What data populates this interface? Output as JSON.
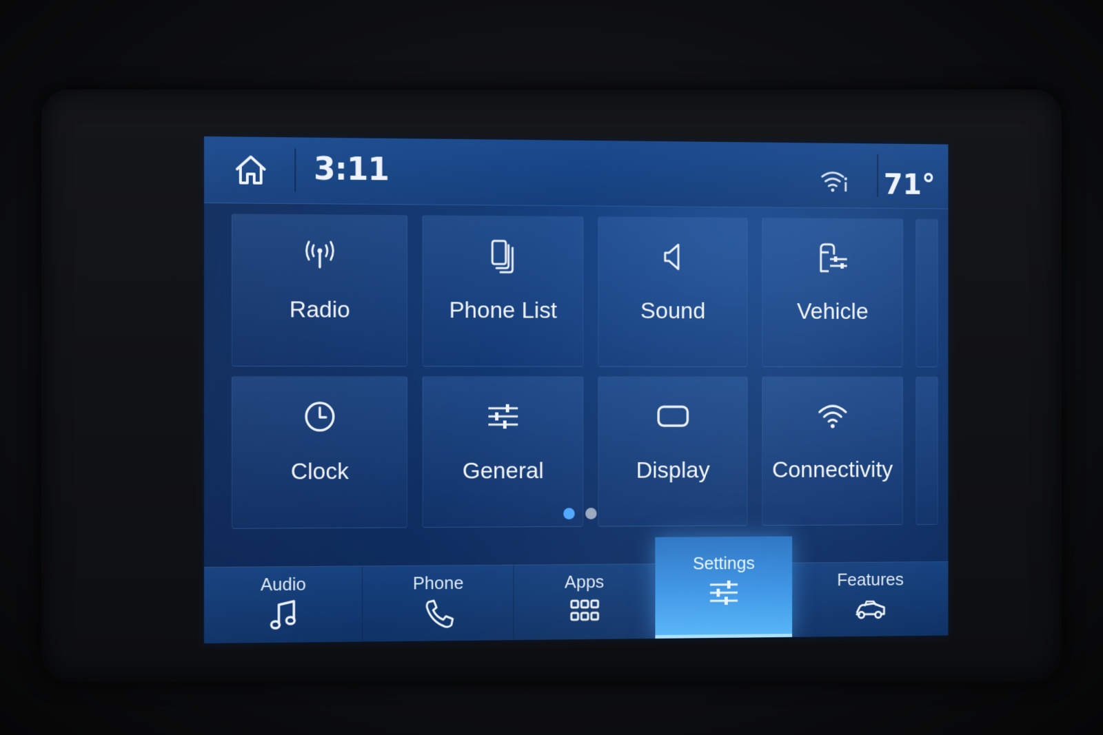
{
  "status_bar": {
    "time": "3:11",
    "temperature": "71°",
    "home_icon": "home-icon",
    "connectivity_icon": "wifi-info-icon"
  },
  "tiles": [
    {
      "label": "Radio",
      "icon": "radio-antenna-icon"
    },
    {
      "label": "Phone List",
      "icon": "phone-list-icon"
    },
    {
      "label": "Sound",
      "icon": "speaker-icon"
    },
    {
      "label": "Vehicle",
      "icon": "vehicle-settings-icon"
    },
    {
      "label": "Clock",
      "icon": "clock-icon"
    },
    {
      "label": "General",
      "icon": "sliders-icon"
    },
    {
      "label": "Display",
      "icon": "display-icon"
    },
    {
      "label": "Connectivity",
      "icon": "wifi-icon"
    }
  ],
  "pager": {
    "pages": 2,
    "active_page": 1
  },
  "bottom_nav": [
    {
      "label": "Audio",
      "icon": "music-note-icon",
      "active": false
    },
    {
      "label": "Phone",
      "icon": "phone-handset-icon",
      "active": false
    },
    {
      "label": "Apps",
      "icon": "apps-grid-icon",
      "active": false
    },
    {
      "label": "Settings",
      "icon": "settings-sliders-icon",
      "active": true
    },
    {
      "label": "Features",
      "icon": "car-icon",
      "active": false
    }
  ],
  "colors": {
    "screen_bg": "#143c78",
    "accent_active": "#3c96e6",
    "pager_active": "#4fa8ff",
    "text": "#eef3fb"
  }
}
